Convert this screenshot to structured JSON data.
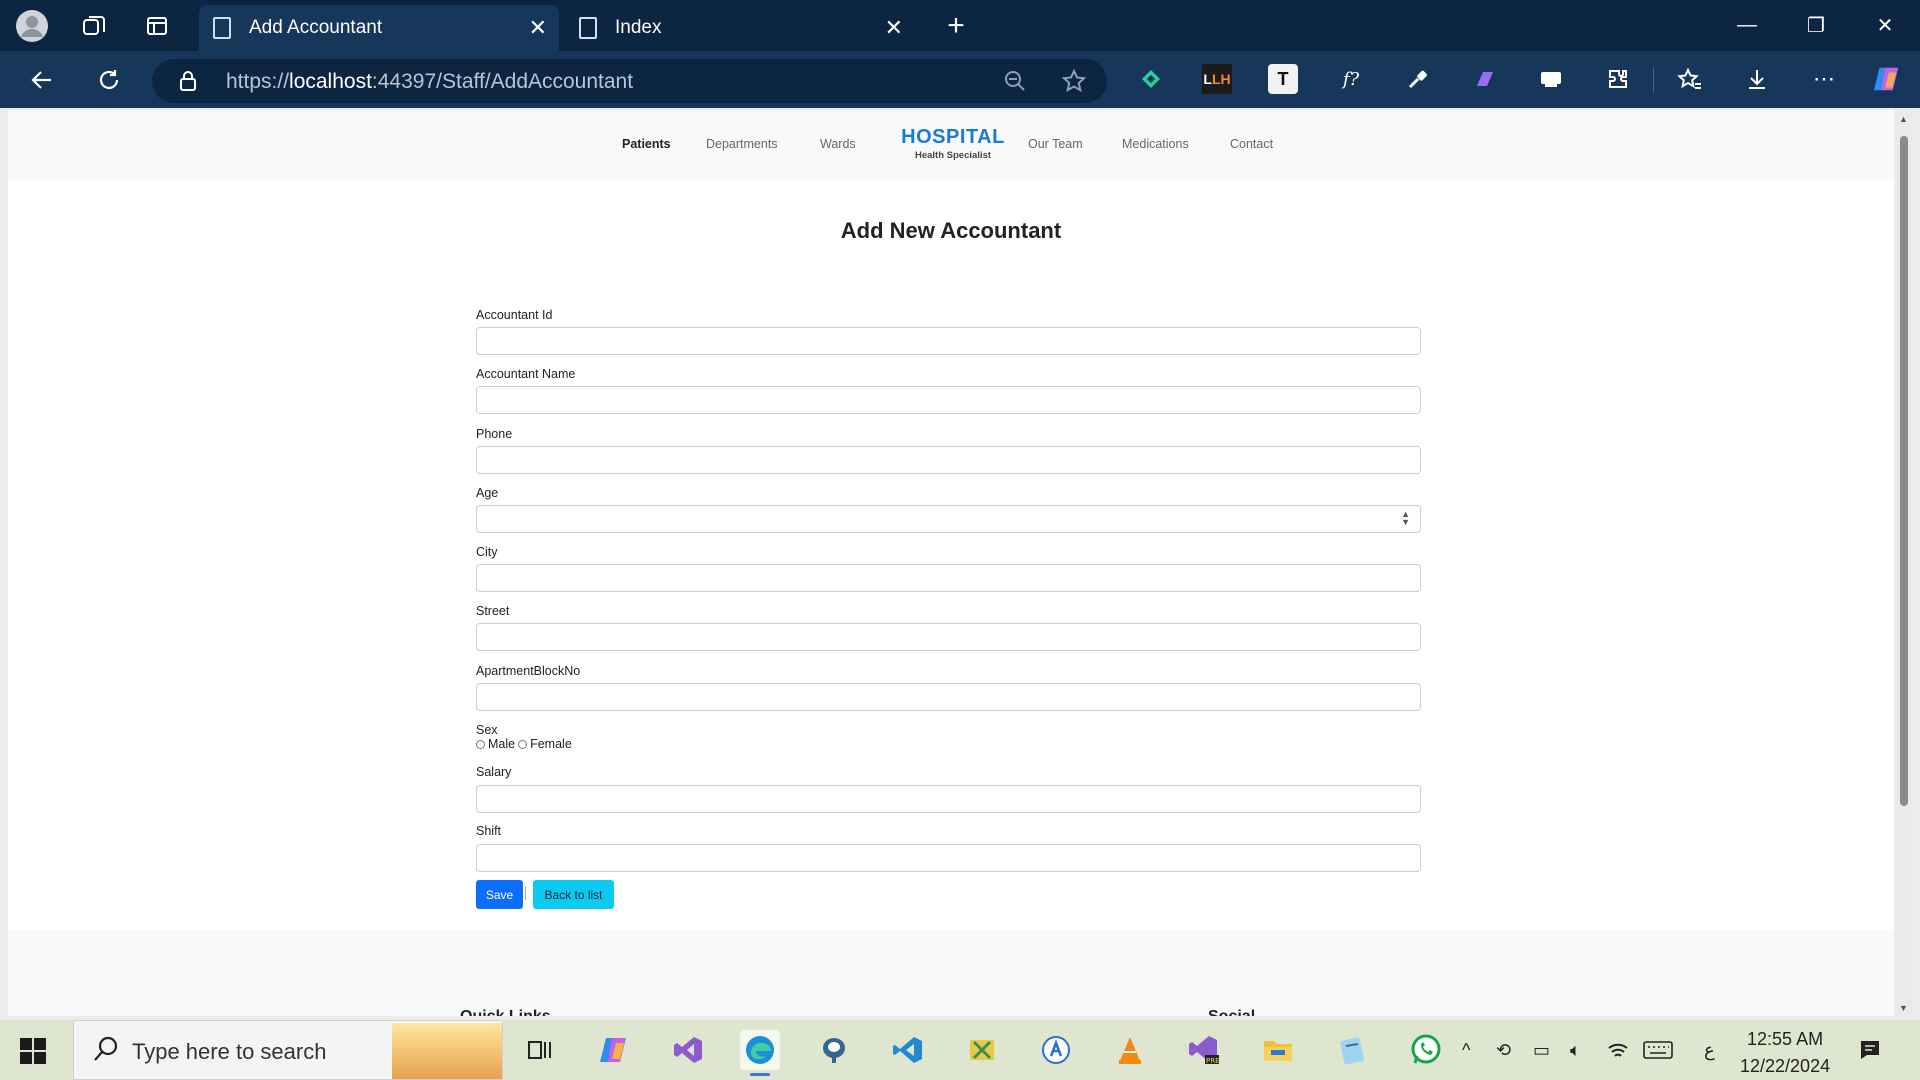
{
  "browser": {
    "tabs": [
      {
        "title": "Add Accountant",
        "active": true
      },
      {
        "title": "Index",
        "active": false
      }
    ],
    "url": {
      "scheme": "https://",
      "host": "localhost",
      "rest": ":44397/Staff/AddAccountant"
    },
    "extensions": [
      "gem-icon",
      "lighthouse-icon",
      "text-icon",
      "fx-icon",
      "eyedropper-icon",
      "copilot-shape-icon",
      "cast-icon",
      "puzzle-icon"
    ],
    "ext_labels": {
      "lh": "LH",
      "t": "T",
      "fx": "f?"
    }
  },
  "site": {
    "brand": {
      "name": "HOSPITAL",
      "tagline": "Health Specialist"
    },
    "menu": [
      "Patients",
      "Departments",
      "Wards",
      "Our Team",
      "Medications",
      "Contact"
    ],
    "active_menu": "Patients"
  },
  "form": {
    "title": "Add New Accountant",
    "fields": [
      {
        "label": "Accountant Id",
        "value": ""
      },
      {
        "label": "Accountant Name",
        "value": ""
      },
      {
        "label": "Phone",
        "value": ""
      },
      {
        "label": "Age",
        "value": ""
      },
      {
        "label": "City",
        "value": ""
      },
      {
        "label": "Street",
        "value": ""
      },
      {
        "label": "ApartmentBlockNo",
        "value": ""
      },
      {
        "label": "Salary",
        "value": ""
      },
      {
        "label": "Shift",
        "value": ""
      }
    ],
    "sex": {
      "label": "Sex",
      "options": [
        "Male",
        "Female"
      ],
      "selected": null
    },
    "save_label": "Save",
    "back_label": "Back to list"
  },
  "footer_peek": [
    "Quick Links",
    "Social"
  ],
  "taskbar": {
    "search_placeholder": "Type here to search",
    "time": "12:55 AM",
    "date": "12/22/2024",
    "input_indicator": "ع"
  },
  "colors": {
    "brand": "#1a7ad4",
    "save": "#0d6efd",
    "back": "#0dcaf0",
    "titlebar": "#0c2540"
  }
}
